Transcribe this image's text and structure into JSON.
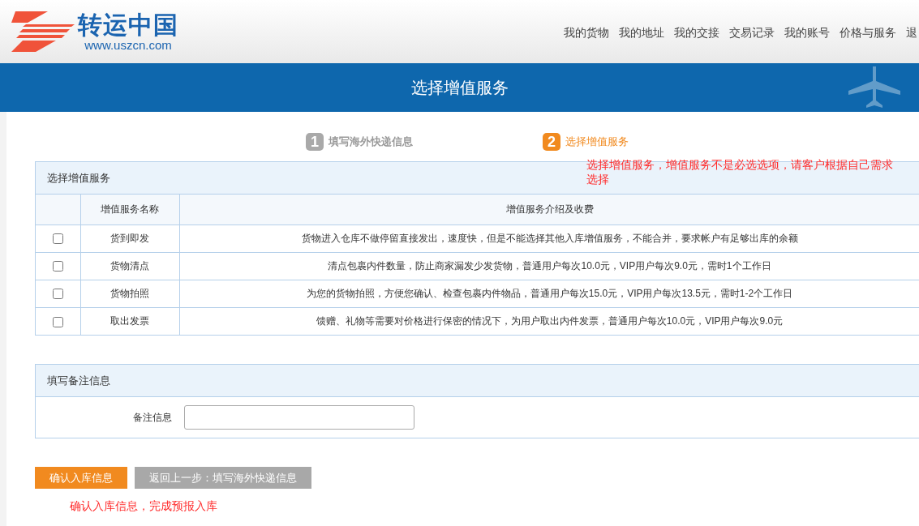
{
  "logo": {
    "name": "转运中国",
    "url": "www.uszcn.com"
  },
  "nav": [
    "我的货物",
    "我的地址",
    "我的交接",
    "交易记录",
    "我的账号",
    "价格与服务",
    "退"
  ],
  "banner": {
    "title": "选择增值服务"
  },
  "steps": [
    {
      "number": "1",
      "label": "填写海外快递信息",
      "selected": false
    },
    {
      "number": "2",
      "label": "选择增值服务",
      "selected": true
    }
  ],
  "steps_note": "选择增值服务，增值服务不是必选选项，请客户根据自己需求选择",
  "services_panel": {
    "title": "选择增值服务",
    "columns": [
      "增值服务名称",
      "增值服务介绍及收费"
    ],
    "rows": [
      {
        "checked": false,
        "name": "货到即发",
        "description": "货物进入仓库不做停留直接发出，速度快，但是不能选择其他入库增值服务，不能合并，要求帐户有足够出库的余额"
      },
      {
        "checked": false,
        "name": "货物清点",
        "description": "清点包裹内件数量，防止商家漏发少发货物，普通用户每次10.0元，VIP用户每次9.0元，需时1个工作日"
      },
      {
        "checked": false,
        "name": "货物拍照",
        "description": "为您的货物拍照，方便您确认、检查包裹内件物品，普通用户每次15.0元，VIP用户每次13.5元，需时1-2个工作日"
      },
      {
        "checked": false,
        "name": "取出发票",
        "description": "馈赠、礼物等需要对价格进行保密的情况下，为用户取出内件发票，普通用户每次10.0元，VIP用户每次9.0元"
      }
    ]
  },
  "remarks_panel": {
    "title": "填写备注信息",
    "field_label": "备注信息"
  },
  "buttons": [
    {
      "label": "确认入库信息",
      "kind": "primary"
    },
    {
      "label": "返回上一步：填写海外快递信息",
      "kind": "secondary"
    }
  ],
  "footer_note": "确认入库信息，完成预报入库"
}
